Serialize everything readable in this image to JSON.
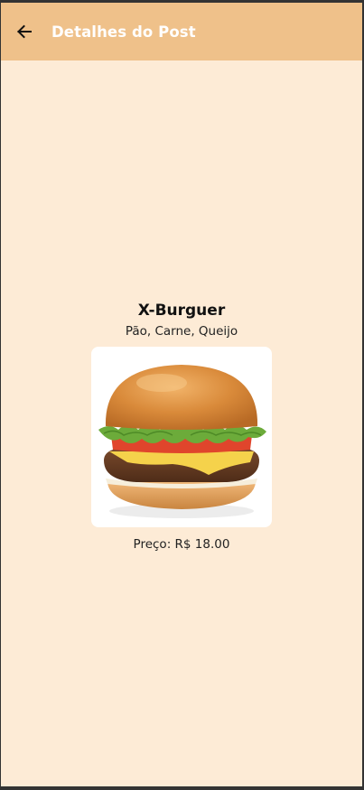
{
  "appbar": {
    "title": "Detalhes do Post",
    "back_icon": "arrow-left-icon"
  },
  "post": {
    "title": "X-Burguer",
    "ingredients": "Pão, Carne, Queijo",
    "image": "burger-photo",
    "price_label": "Preço: R$ 18.00"
  },
  "colors": {
    "appbar_bg": "#efc18a",
    "page_bg": "#fdebd6"
  }
}
